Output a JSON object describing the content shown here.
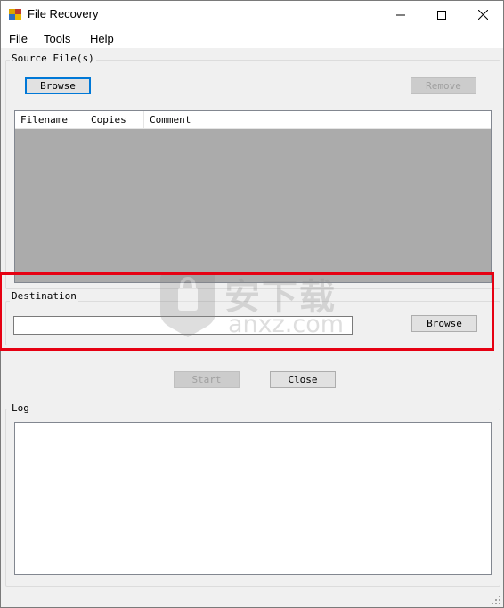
{
  "window": {
    "title": "File Recovery",
    "controls": {
      "minimize": "—",
      "maximize": "☐",
      "close": "✕"
    }
  },
  "menu": {
    "items": [
      "File",
      "Tools",
      "Help"
    ]
  },
  "source": {
    "group_label": "Source File(s)",
    "browse_label": "Browse",
    "remove_label": "Remove",
    "columns": [
      "Filename",
      "Copies",
      "Comment"
    ]
  },
  "destination": {
    "group_label": "Destination",
    "path_value": "",
    "browse_label": "Browse"
  },
  "actions": {
    "start_label": "Start",
    "close_label": "Close"
  },
  "log": {
    "group_label": "Log",
    "content": ""
  },
  "watermark": {
    "text_cn": "安下载",
    "text_en": "anxz.com"
  },
  "colors": {
    "highlight": "#e60012",
    "focus": "#0078d7",
    "list_bg": "#ababab"
  }
}
